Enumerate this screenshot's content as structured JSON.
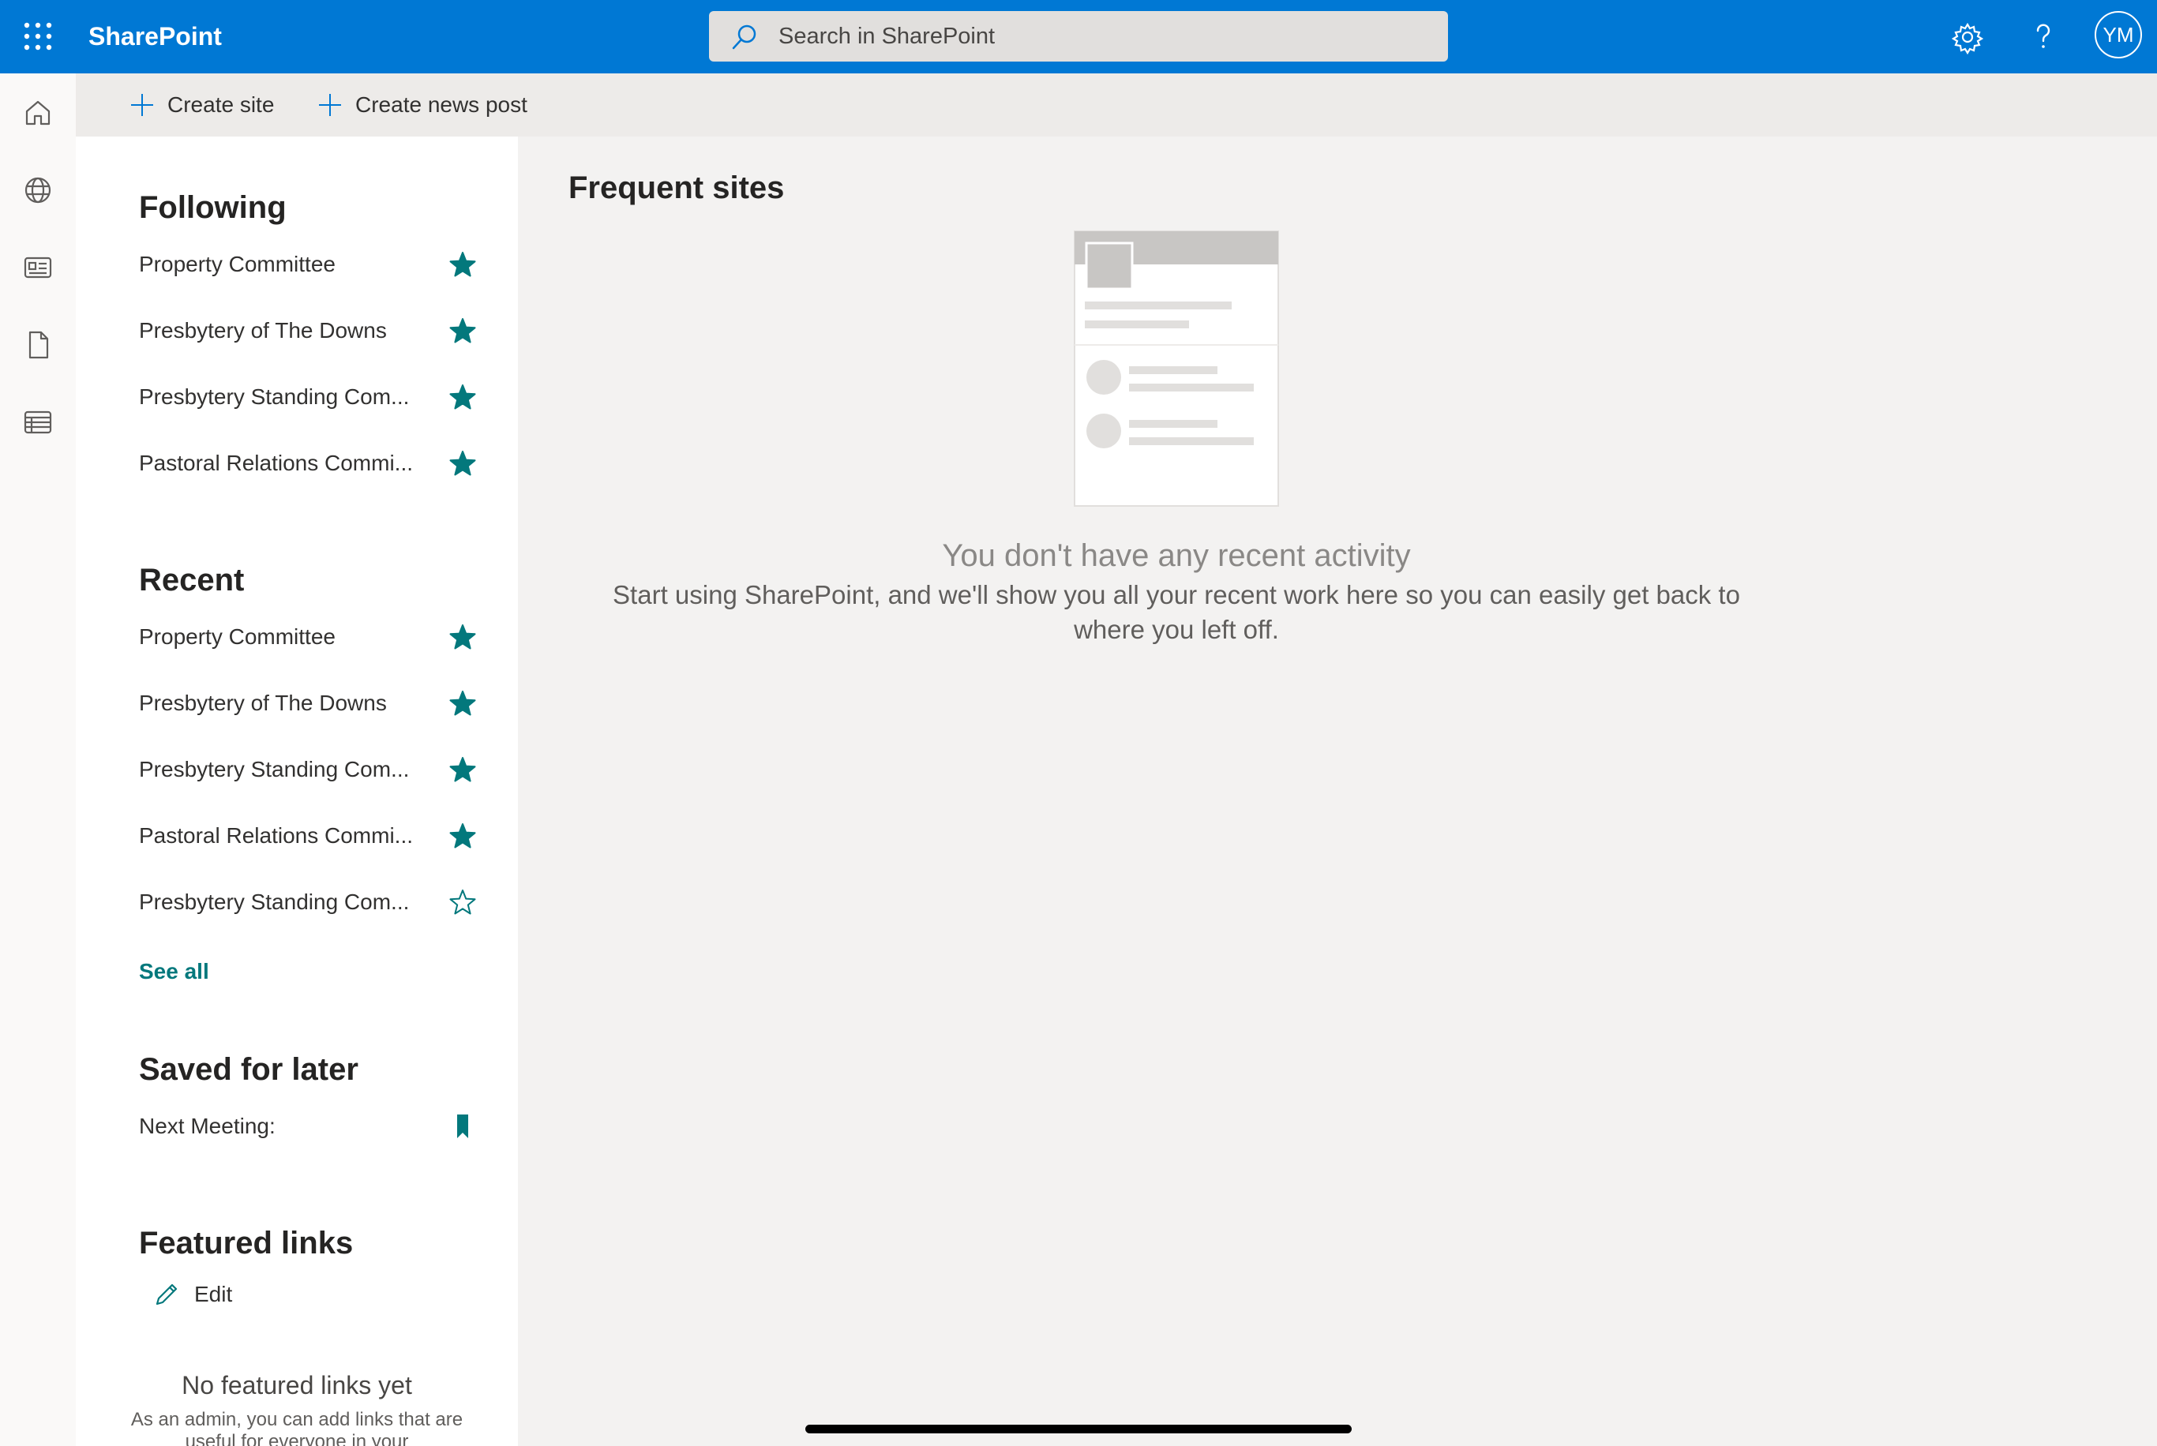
{
  "app": {
    "name": "SharePoint"
  },
  "search": {
    "placeholder": "Search in SharePoint"
  },
  "header": {
    "avatar_initials": "YM",
    "accent_color": "#0078d4"
  },
  "commands": {
    "create_site": "Create site",
    "create_news": "Create news post"
  },
  "following": {
    "title": "Following",
    "items": [
      {
        "label": "Property Committee",
        "starred": true
      },
      {
        "label": "Presbytery of The Downs",
        "starred": true
      },
      {
        "label": "Presbytery Standing Com...",
        "starred": true
      },
      {
        "label": "Pastoral Relations Commi...",
        "starred": true
      }
    ]
  },
  "recent": {
    "title": "Recent",
    "items": [
      {
        "label": "Property Committee",
        "starred": true
      },
      {
        "label": "Presbytery of The Downs",
        "starred": true
      },
      {
        "label": "Presbytery Standing Com...",
        "starred": true
      },
      {
        "label": "Pastoral Relations Commi...",
        "starred": true
      },
      {
        "label": "Presbytery Standing Com...",
        "starred": false
      }
    ],
    "see_all": "See all"
  },
  "saved": {
    "title": "Saved for later",
    "items": [
      {
        "label": "Next Meeting:"
      }
    ]
  },
  "featured": {
    "title": "Featured links",
    "edit_label": "Edit",
    "empty_title": "No featured links yet",
    "empty_desc": "As an admin, you can add links that are useful for everyone in your"
  },
  "main": {
    "title": "Frequent sites",
    "empty_title": "You don't have any recent activity",
    "empty_desc": "Start using SharePoint, and we'll show you all your recent work here so you can easily get back to where you left off."
  },
  "theme": {
    "teal": "#03787c"
  }
}
